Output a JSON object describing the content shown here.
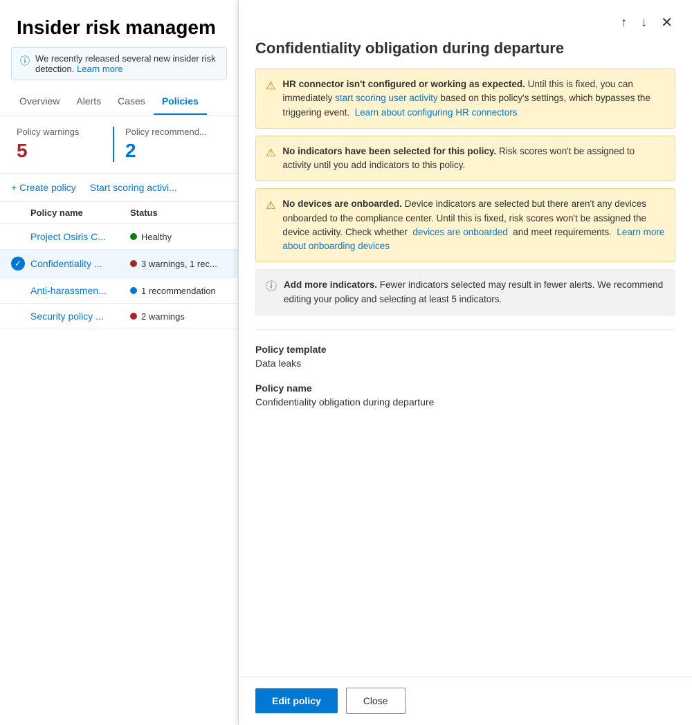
{
  "app": {
    "title": "Insider risk managem",
    "info_banner": {
      "text": "We recently released several new insider risk ",
      "link": "Learn more",
      "icon": "ⓘ"
    }
  },
  "nav": {
    "tabs": [
      {
        "label": "Overview",
        "active": false
      },
      {
        "label": "Alerts",
        "active": false
      },
      {
        "label": "Cases",
        "active": false
      },
      {
        "label": "Policies",
        "active": true
      }
    ]
  },
  "stats": {
    "warnings_label": "Policy warnings",
    "warnings_value": "5",
    "recommendations_label": "Policy recommend...",
    "recommendations_value": "2"
  },
  "actions": {
    "create_policy": "+ Create policy",
    "start_scoring": "Start scoring activi..."
  },
  "table": {
    "col_name": "Policy name",
    "col_status": "Status",
    "policies": [
      {
        "name": "Project Osiris C...",
        "status": "Healthy",
        "dot": "green",
        "selected": false,
        "check": false
      },
      {
        "name": "Confidentiality ...",
        "status": "3 warnings, 1 rec...",
        "dot": "red",
        "selected": true,
        "check": true
      },
      {
        "name": "Anti-harassmen...",
        "status": "1 recommendation",
        "dot": "blue",
        "selected": false,
        "check": false
      },
      {
        "name": "Security policy ...",
        "status": "2 warnings",
        "dot": "red",
        "selected": false,
        "check": false
      }
    ]
  },
  "flyout": {
    "title": "Confidentiality obligation during departure",
    "nav_up": "↑",
    "nav_down": "↓",
    "close": "✕",
    "alerts": [
      {
        "type": "warning",
        "bold": "HR connector isn't configured or working as expected.",
        "text_before": "",
        "link1": {
          "text": "start scoring user activity",
          "href": "#"
        },
        "text_middle": " based on this policy's settings, which bypasses the triggering event. ",
        "link2": {
          "text": "Learn about configuring HR connectors",
          "href": "#"
        },
        "text_after": "",
        "suffix": " Until this is fixed, you can immediately "
      },
      {
        "type": "warning",
        "bold": "No indicators have been selected for this policy.",
        "text": " Risk scores won't be assigned to activity until you add indicators to this policy."
      },
      {
        "type": "warning",
        "bold": "No devices are onboarded.",
        "text_before": " Device indicators are selected but there aren't any devices onboarded to the compliance center. Until this is fixed, risk scores won't be assigned the device activity. Check whether ",
        "link1": {
          "text": "devices are onboarded",
          "href": "#"
        },
        "text_middle": " and meet requirements. ",
        "link2": {
          "text": "Learn more about onboarding devices",
          "href": "#"
        }
      },
      {
        "type": "info",
        "bold": "Add more indicators.",
        "text": " Fewer indicators selected may result in fewer alerts. We recommend editing your policy and selecting at least 5 indicators."
      }
    ],
    "policy_template_label": "Policy template",
    "policy_template_value": "Data leaks",
    "policy_name_label": "Policy name",
    "policy_name_value": "Confidentiality obligation during departure",
    "footer": {
      "edit_label": "Edit policy",
      "close_label": "Close"
    }
  }
}
